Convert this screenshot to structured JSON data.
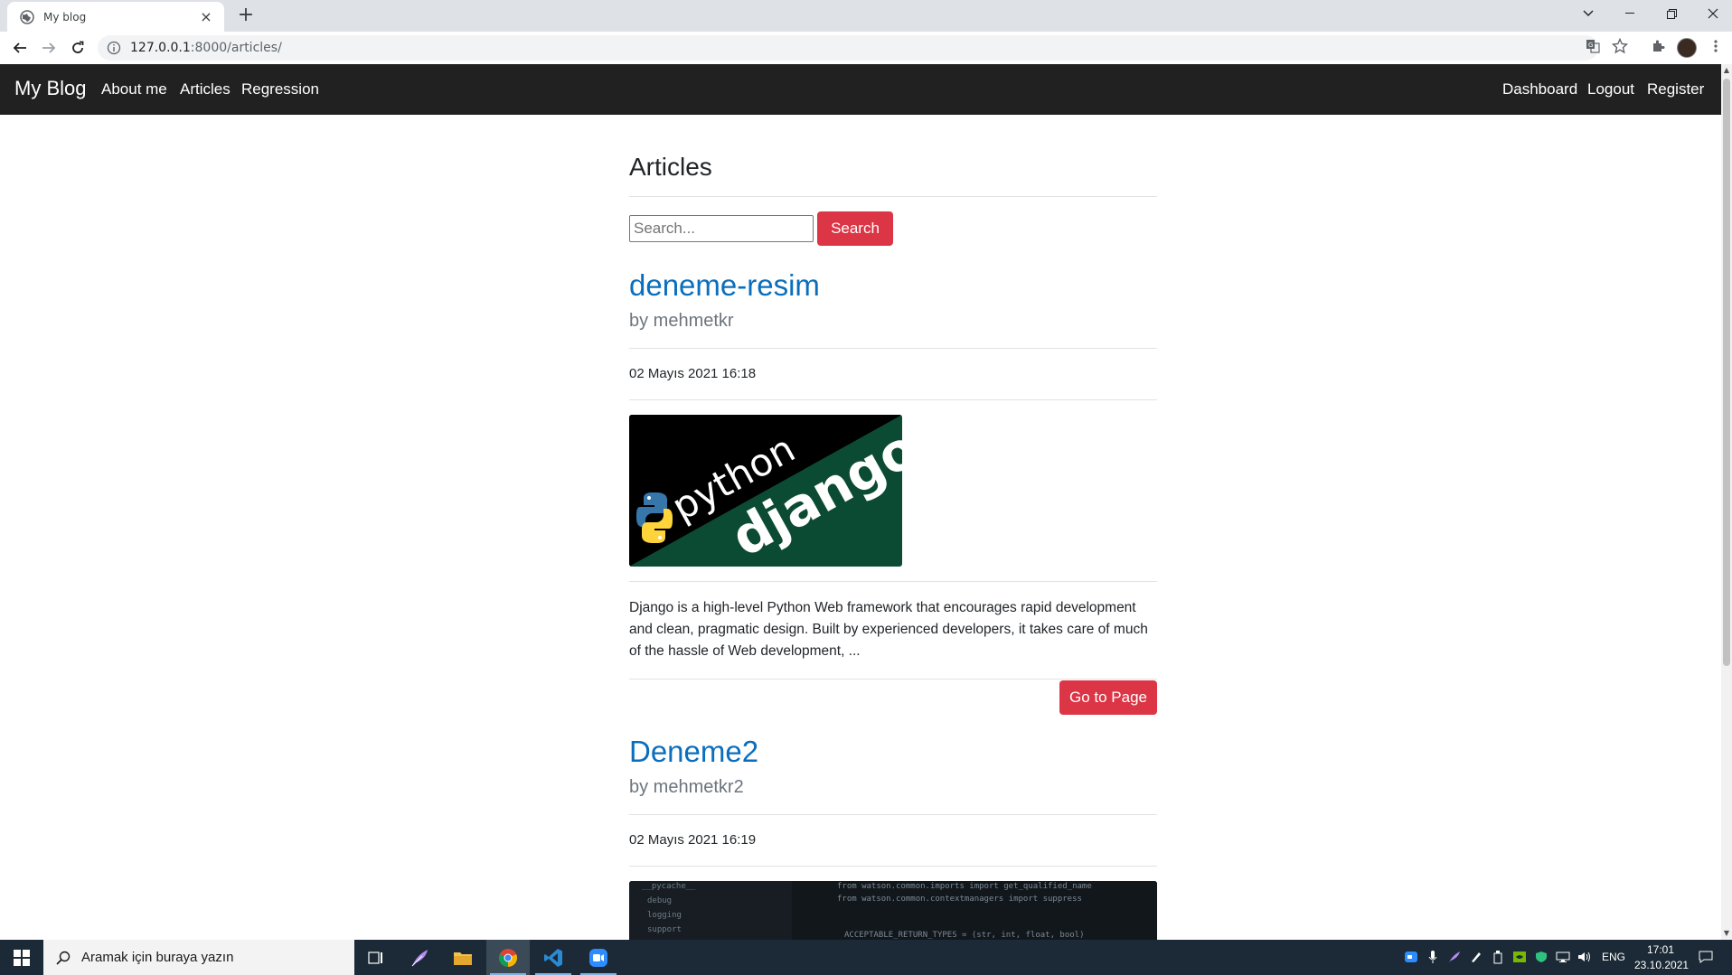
{
  "browser": {
    "tab_title": "My blog",
    "tab_close": "×",
    "new_tab": "+",
    "url_host": "127.0.0.1",
    "url_rest": ":8000/articles/"
  },
  "navbar": {
    "brand": "My Blog",
    "left_links": [
      "About me",
      "Articles",
      "Regression"
    ],
    "right_links": [
      "Dashboard",
      "Logout",
      "Register"
    ],
    "background": "#212121"
  },
  "page": {
    "heading": "Articles",
    "search": {
      "placeholder": "Search...",
      "value": "",
      "button_label": "Search"
    },
    "accent_color": "#dc3545",
    "link_color": "#0a6ebd"
  },
  "articles": [
    {
      "title": "deneme-resim",
      "author": "by mehmetkr",
      "date": "02 Mayıs 2021 16:18",
      "image": {
        "kind": "python-django-logo",
        "word1": "python",
        "word2": "django"
      },
      "excerpt": "Django is a high-level Python Web framework that encourages rapid development and clean, pragmatic design. Built by experienced developers, it takes care of much of the hassle of Web development, ...",
      "button_label": "Go to Page"
    },
    {
      "title": "Deneme2",
      "author": "by mehmetkr2",
      "date": "02 Mayıs 2021 16:19",
      "image": {
        "kind": "code-screenshot",
        "code_lines": [
          "from watson.common.imports import get_qualified_name",
          "from watson.common.contextmanagers import suppress",
          "",
          "ACCEPTABLE_RETURN_TYPES = (str, int, float, bool)"
        ],
        "tree_items": [
          "__pycache__",
          "debug",
          "logging",
          "support"
        ]
      }
    }
  ],
  "taskbar": {
    "search_placeholder": "Aramak için buraya yazın",
    "language": "ENG",
    "time": "17:01",
    "date": "23.10.2021",
    "apps": [
      "task-view",
      "feather-app",
      "file-explorer",
      "chrome",
      "vscode",
      "zoom"
    ]
  }
}
